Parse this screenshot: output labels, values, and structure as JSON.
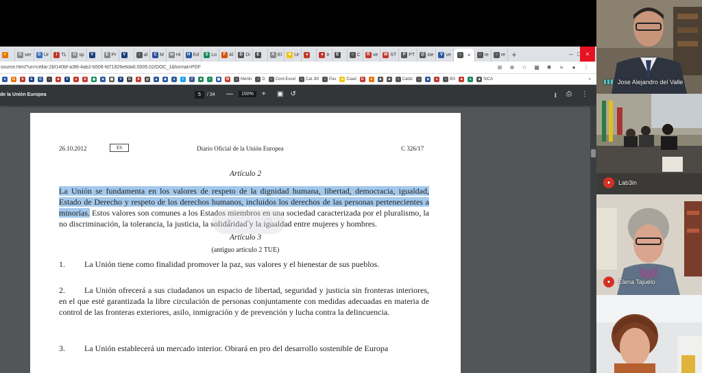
{
  "browser": {
    "tabs": [
      {
        "label": "",
        "color": "#e8710a",
        "glyph": "⚡"
      },
      {
        "label": "ser",
        "color": "#888888",
        "glyph": "G"
      },
      {
        "label": "Ur",
        "color": "#3d6fb6",
        "glyph": "G"
      },
      {
        "label": "TL",
        "color": "#c0392b",
        "glyph": "i"
      },
      {
        "label": "sp",
        "color": "#888888",
        "glyph": "G"
      },
      {
        "label": "",
        "color": "#1a3d7c",
        "glyph": "V"
      },
      {
        "label": "Pr",
        "color": "#888888",
        "glyph": "E"
      },
      {
        "label": "",
        "color": "#1a3d7c",
        "glyph": "V"
      },
      {
        "label": "al",
        "color": "#555555",
        "glyph": "○"
      },
      {
        "label": "M",
        "color": "#2a4d9b",
        "glyph": "C"
      },
      {
        "label": "Hi",
        "color": "#888888",
        "glyph": "w"
      },
      {
        "label": "Ed",
        "color": "#2c5aa0",
        "glyph": "H"
      },
      {
        "label": "Lo",
        "color": "#1b8a5a",
        "glyph": "S"
      },
      {
        "label": "Al",
        "color": "#d35400",
        "glyph": "F"
      },
      {
        "label": "Di",
        "color": "#555555",
        "glyph": "D"
      },
      {
        "label": "",
        "color": "#4a4a4a",
        "glyph": "E"
      },
      {
        "label": "El",
        "color": "#888888",
        "glyph": "A"
      },
      {
        "label": "Ur",
        "color": "#f1c40f",
        "glyph": "■"
      },
      {
        "label": "",
        "color": "#c0392b",
        "glyph": "●"
      },
      {
        "label": "tr",
        "color": "#c0392b",
        "glyph": "●"
      },
      {
        "label": "",
        "color": "#4a4a4a",
        "glyph": "E"
      },
      {
        "label": "C",
        "color": "#555555",
        "glyph": "○"
      },
      {
        "label": "ve",
        "color": "#c0392b",
        "glyph": "R"
      },
      {
        "label": "ST",
        "color": "#c0392b",
        "glyph": "W"
      },
      {
        "label": "PT",
        "color": "#555555",
        "glyph": "P"
      },
      {
        "label": "ste",
        "color": "#555555",
        "glyph": "@"
      },
      {
        "label": "ve",
        "color": "#2c5aa0",
        "glyph": "V"
      }
    ],
    "active_tab": {
      "label": "",
      "close": "×"
    },
    "trailing_tabs": [
      {
        "label": "re",
        "color": "#555555",
        "glyph": "○"
      },
      {
        "label": "re",
        "color": "#555555",
        "glyph": "○"
      }
    ],
    "new_tab": "+",
    "window_controls": {
      "minimize": "–",
      "maximize": "□",
      "close": "×"
    },
    "url": "source.html?uri=cellar:2bf140bf-a3f8-4ab2-b506-fd71826e6da6.0005.02/DOC_1&format=PDF",
    "address_icons": [
      "⊞",
      "⊕",
      "☆",
      "▦",
      "✱",
      "≡",
      "●",
      "⋮"
    ],
    "bookmarks": [
      {
        "label": "",
        "color": "#2c5aa0",
        "glyph": "●"
      },
      {
        "label": "",
        "color": "#e8710a",
        "glyph": "G"
      },
      {
        "label": "",
        "color": "#c0392b",
        "glyph": "b"
      },
      {
        "label": "",
        "color": "#1a3d7c",
        "glyph": "E"
      },
      {
        "label": "",
        "color": "#2c5aa0",
        "glyph": "C"
      },
      {
        "label": "",
        "color": "#444444",
        "glyph": "–"
      },
      {
        "label": "",
        "color": "#c0392b",
        "glyph": "■"
      },
      {
        "label": "",
        "color": "#1a3d7c",
        "glyph": "V"
      },
      {
        "label": "",
        "color": "#c0392b",
        "glyph": "●"
      },
      {
        "label": "",
        "color": "#c0392b",
        "glyph": "A"
      },
      {
        "label": "",
        "color": "#1b8a5a",
        "glyph": "◉"
      },
      {
        "label": "",
        "color": "#2c5aa0",
        "glyph": "■"
      },
      {
        "label": "",
        "color": "#555555",
        "glyph": "▣"
      },
      {
        "label": "",
        "color": "#1a3d7c",
        "glyph": "V"
      },
      {
        "label": "",
        "color": "#444444",
        "glyph": "G"
      },
      {
        "label": "",
        "color": "#c0392b",
        "glyph": "A"
      },
      {
        "label": "",
        "color": "#444444",
        "glyph": "◎"
      },
      {
        "label": "",
        "color": "#2c5aa0",
        "glyph": "▲"
      },
      {
        "label": "",
        "color": "#2c5aa0",
        "glyph": "◈"
      },
      {
        "label": "",
        "color": "#2c5aa0",
        "glyph": "●"
      },
      {
        "label": "",
        "color": "#1da1f2",
        "glyph": "t"
      },
      {
        "label": "",
        "color": "#3b5998",
        "glyph": "f"
      },
      {
        "label": "",
        "color": "#1b8a5a",
        "glyph": "■"
      },
      {
        "label": "",
        "color": "#1b8a5a",
        "glyph": "≈"
      },
      {
        "label": "",
        "color": "#2c5aa0",
        "glyph": "▣"
      },
      {
        "label": "",
        "color": "#c0392b",
        "glyph": "M"
      },
      {
        "label": "Merlin",
        "color": "#555555",
        "glyph": "○"
      },
      {
        "label": "D",
        "color": "#555555",
        "glyph": "○"
      },
      {
        "label": "Cont-Excel",
        "color": "#555555",
        "glyph": "○"
      },
      {
        "label": "Cat JM",
        "color": "#555555",
        "glyph": "○"
      },
      {
        "label": "Pas",
        "color": "#555555",
        "glyph": "○"
      },
      {
        "label": "Cuad",
        "color": "#f1c40f",
        "glyph": "■"
      },
      {
        "label": "",
        "color": "#c0392b",
        "glyph": "D"
      },
      {
        "label": "",
        "color": "#e8710a",
        "glyph": "●"
      },
      {
        "label": "",
        "color": "#555555",
        "glyph": "■"
      },
      {
        "label": "",
        "color": "#555555",
        "glyph": "■"
      },
      {
        "label": "Cádiz",
        "color": "#555555",
        "glyph": "○"
      },
      {
        "label": "",
        "color": "#555555",
        "glyph": "○"
      },
      {
        "label": "",
        "color": "#2c5aa0",
        "glyph": "■"
      },
      {
        "label": "",
        "color": "#c0392b",
        "glyph": "●"
      },
      {
        "label": "BS",
        "color": "#555555",
        "glyph": "○"
      },
      {
        "label": "",
        "color": "#c0392b",
        "glyph": "■"
      },
      {
        "label": "",
        "color": "#1b8a5a",
        "glyph": "●"
      },
      {
        "label": "SICA",
        "color": "#555555",
        "glyph": "■"
      }
    ],
    "bookmarks_more": "»"
  },
  "pdf_toolbar": {
    "title": "de la Unión Europea",
    "page_current": "5",
    "page_total": "/ 34",
    "zoom_out": "—",
    "zoom_value": "150%",
    "zoom_in": "+",
    "fit_icon": "▣",
    "rotate_icon": "↺",
    "download_icon": "⭳",
    "print_icon": "⎙",
    "more_icon": "⋮"
  },
  "document": {
    "header_date": "26.10.2012",
    "header_lang": "ES",
    "header_journal": "Diario Oficial de la Unión Europea",
    "header_pageref": "C  326/17",
    "art2_title": "Artículo 2",
    "art2_highlight": "La Unión se fundamenta en los valores de respeto de la dignidad humana, libertad, democracia, igualdad, Estado de Derecho y respeto de los derechos humanos, incluidos los derechos de las personas pertenecientes a minorías.",
    "art2_rest": " Estos valores son comunes a los Estados miembros en una sociedad caracterizada por el pluralismo, la no discriminación, la tolerancia, la justicia, la solidaridad y la igualdad entre mujeres y hombres.",
    "art3_title": "Artículo 3",
    "art3_sub": "(antiguo artículo 2 TUE)",
    "p1_num": "1.",
    "p1_text": "La Unión tiene como finalidad promover la paz, sus valores y el bienestar de sus pueblos.",
    "p2_num": "2.",
    "p2_text": "La Unión ofrecerá a sus ciudadanos un espacio de libertad, seguridad y justicia sin fronteras interiores, en el que esté garantizada la libre circulación de personas conjuntamente con medidas adecuadas en materia de control de las fronteras exteriores, asilo, inmigración y de prevención y lucha contra la delincuencia.",
    "p3_num": "3.",
    "p3_text": "La Unión establecerá un mercado interior. Obrará en pro del desarrollo sostenible de Europa"
  },
  "participants": [
    {
      "name": "Jose Alejandro del Valle",
      "mic": "on"
    },
    {
      "name": "Lab3in",
      "mic": "off"
    },
    {
      "name": "Elena Tajuelo",
      "mic": "off"
    },
    {
      "name": "",
      "mic": "none"
    }
  ],
  "colors": {
    "highlight": "#a3c9ec",
    "mic_off": "#d93025",
    "toolbar": "#323639",
    "viewer_bg": "#525659"
  }
}
